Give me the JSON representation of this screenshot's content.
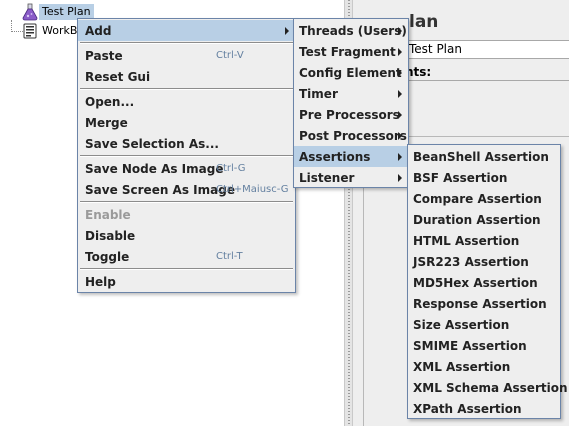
{
  "tree": {
    "items": [
      {
        "label": "Test Plan",
        "icon": "test-plan-flask-icon"
      },
      {
        "label": "WorkB",
        "icon": "workbench-icon"
      }
    ]
  },
  "right_panel": {
    "title_fragment": "lan",
    "name_value": "Test Plan",
    "comments_label": "nts:"
  },
  "context_menu": {
    "items": [
      {
        "label": "Add",
        "accel": "",
        "submenu": true
      },
      {
        "label": "Paste",
        "accel": "Ctrl-V"
      },
      {
        "label": "Reset Gui",
        "accel": ""
      },
      {
        "label": "Open...",
        "accel": ""
      },
      {
        "label": "Merge",
        "accel": ""
      },
      {
        "label": "Save Selection As...",
        "accel": ""
      },
      {
        "label": "Save Node As Image",
        "accel": "Ctrl-G"
      },
      {
        "label": "Save Screen As Image",
        "accel": "Ctrl+Maiusc-G"
      },
      {
        "label": "Enable",
        "accel": "",
        "disabled": true
      },
      {
        "label": "Disable",
        "accel": ""
      },
      {
        "label": "Toggle",
        "accel": "Ctrl-T"
      },
      {
        "label": "Help",
        "accel": ""
      }
    ]
  },
  "add_menu": {
    "items": [
      {
        "label": "Threads (Users)"
      },
      {
        "label": "Test Fragment"
      },
      {
        "label": "Config Element"
      },
      {
        "label": "Timer"
      },
      {
        "label": "Pre Processors"
      },
      {
        "label": "Post Processors"
      },
      {
        "label": "Assertions"
      },
      {
        "label": "Listener"
      }
    ]
  },
  "assertions_menu": {
    "items": [
      {
        "label": "BeanShell Assertion"
      },
      {
        "label": "BSF Assertion"
      },
      {
        "label": "Compare Assertion"
      },
      {
        "label": "Duration Assertion"
      },
      {
        "label": "HTML Assertion"
      },
      {
        "label": "JSR223 Assertion"
      },
      {
        "label": "MD5Hex Assertion"
      },
      {
        "label": "Response Assertion"
      },
      {
        "label": "Size Assertion"
      },
      {
        "label": "SMIME Assertion"
      },
      {
        "label": "XML Assertion"
      },
      {
        "label": "XML Schema Assertion"
      },
      {
        "label": "XPath Assertion"
      }
    ]
  },
  "colors": {
    "selection": "#b8cfe5",
    "menu_bg": "#eeeeee",
    "menu_border": "#6b84a8",
    "accelerator": "#6480a0",
    "disabled": "#9a9a9a"
  }
}
